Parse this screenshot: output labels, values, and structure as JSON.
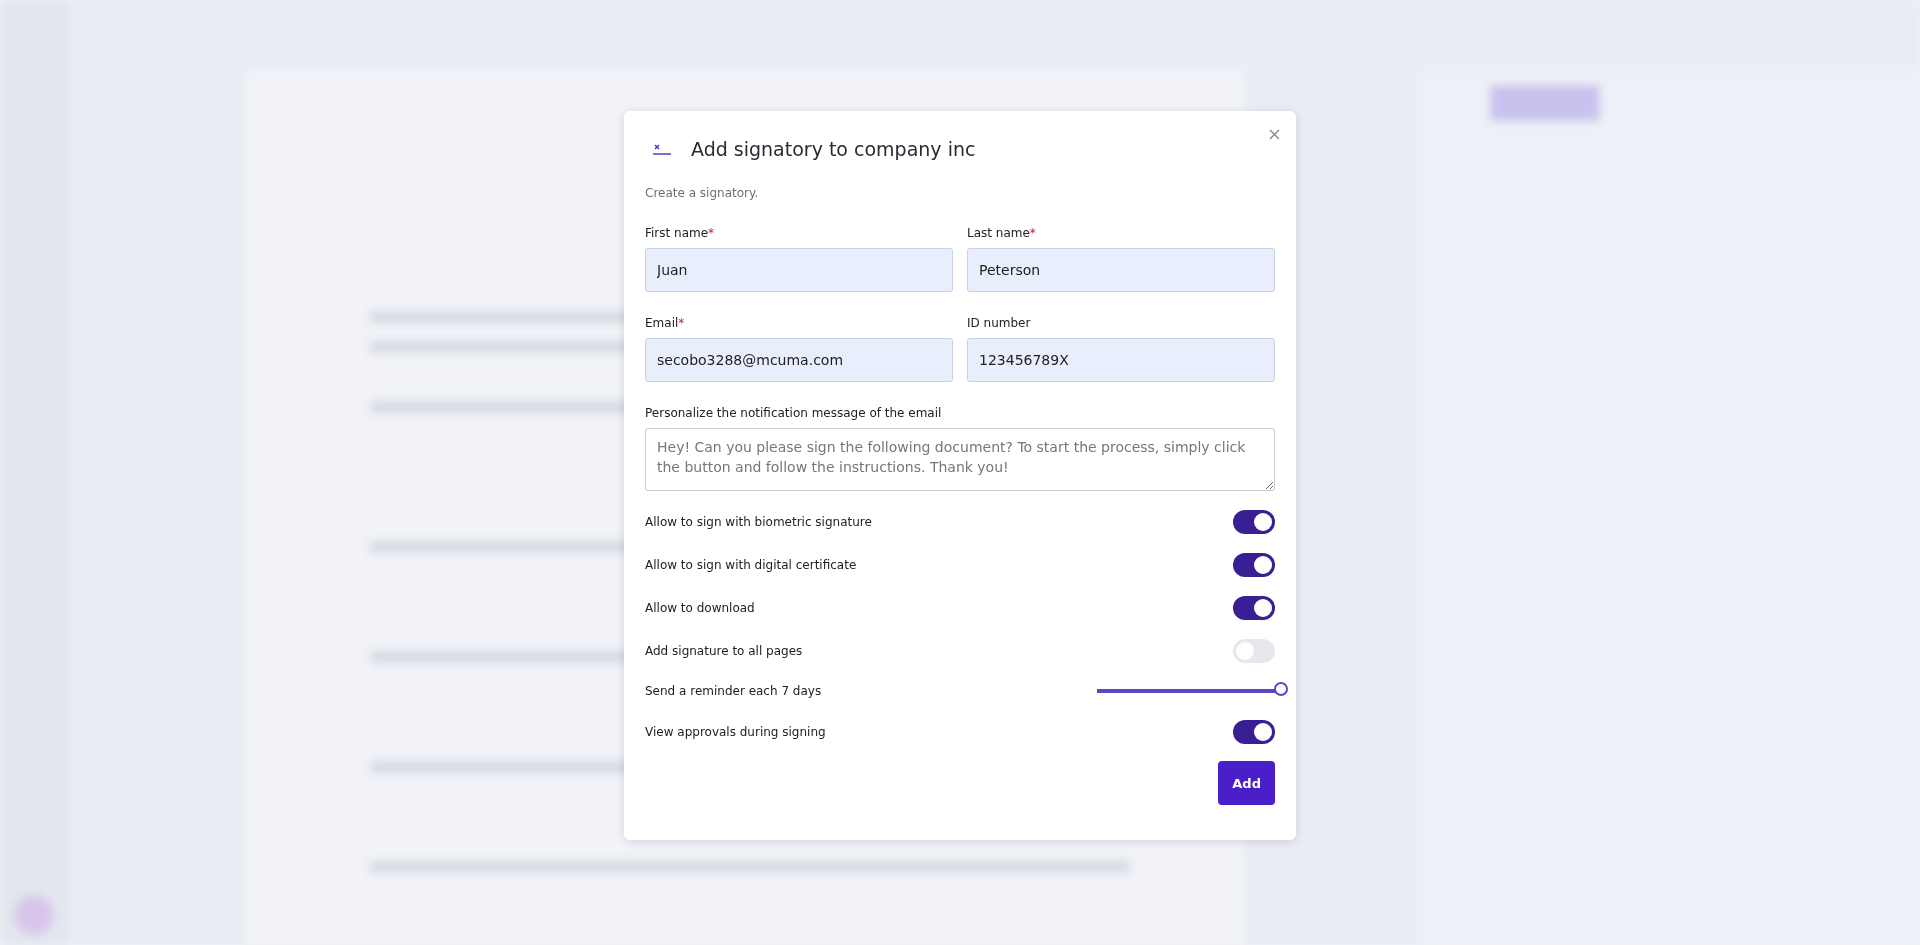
{
  "dialog": {
    "title": "Add signatory to company inc",
    "subtitle": "Create a signatory.",
    "fields": [
      {
        "label": "First name",
        "required_mark": "*",
        "value": "Juan"
      },
      {
        "label": "Last name",
        "required_mark": "*",
        "value": "Peterson"
      },
      {
        "label": "Email",
        "required_mark": "*",
        "value": "secobo3288@mcuma.com"
      },
      {
        "label": "ID number",
        "value": "123456789X"
      }
    ],
    "message": {
      "label": "Personalize the notification message of the email",
      "placeholder": "Hey! Can you please sign the following document? To start the process, simply click the button and follow the instructions. Thank you!"
    },
    "options": [
      {
        "kind": "toggle",
        "label": "Allow to sign with biometric signature",
        "on": true
      },
      {
        "kind": "toggle",
        "label": "Allow to sign with digital certificate",
        "on": true
      },
      {
        "kind": "toggle",
        "label": "Allow to download",
        "on": true
      },
      {
        "kind": "toggle",
        "label": "Add signature to all pages",
        "on": false
      },
      {
        "kind": "slider",
        "label": "Send a reminder each 7 days",
        "level": 1
      },
      {
        "kind": "toggle",
        "label": "View approvals during signing",
        "on": true
      }
    ],
    "button": "Add"
  }
}
